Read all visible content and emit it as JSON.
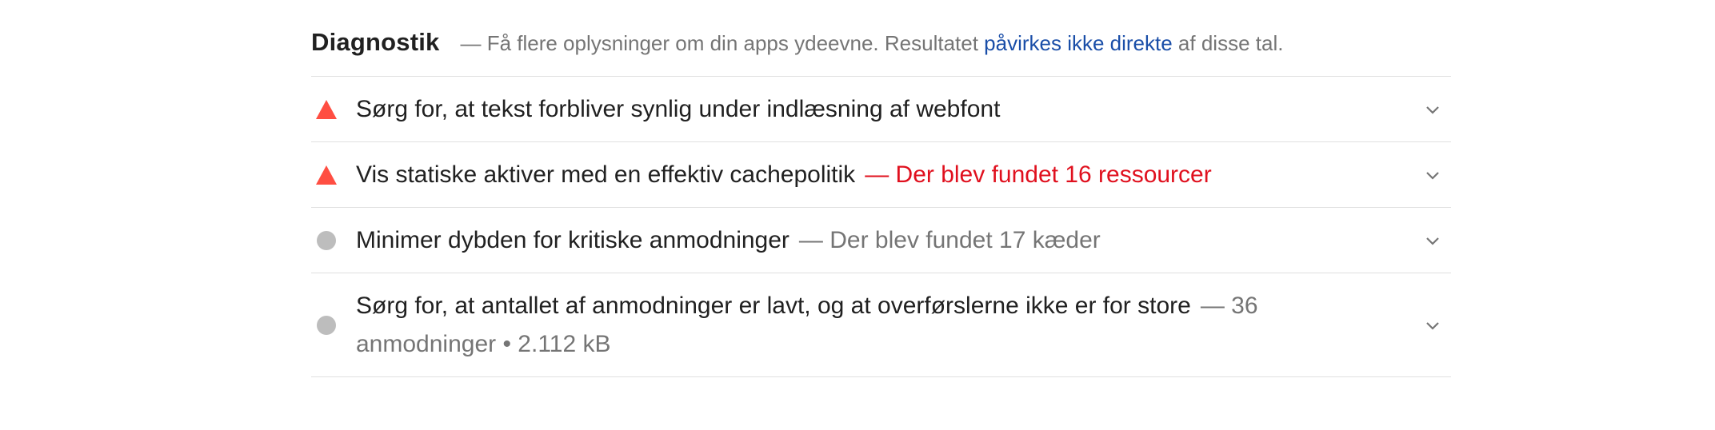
{
  "section": {
    "title": "Diagnostik",
    "desc_prefix": "— Få flere oplysninger om din apps ydeevne. Resultatet ",
    "desc_link": "påvirkes ikke direkte",
    "desc_suffix": " af disse tal."
  },
  "audits": [
    {
      "icon": "warning-triangle-icon",
      "status": "fail",
      "title": "Sørg for, at tekst forbliver synlig under indlæsning af webfont",
      "display_value": ""
    },
    {
      "icon": "warning-triangle-icon",
      "status": "fail",
      "title": "Vis statiske aktiver med en effektiv cachepolitik",
      "display_value": "— Der blev fundet 16 ressourcer"
    },
    {
      "icon": "neutral-circle-icon",
      "status": "informative",
      "title": "Minimer dybden for kritiske anmodninger",
      "display_value": "— Der blev fundet 17 kæder"
    },
    {
      "icon": "neutral-circle-icon",
      "status": "informative",
      "title": "Sørg for, at antallet af anmodninger er lavt, og at overførslerne ikke er for store",
      "display_value": "— 36 anmodninger • 2.112 kB"
    }
  ],
  "colors": {
    "fail": "#ff4e42",
    "fail_text": "#e0101e",
    "neutral": "#bdbdbd",
    "link": "#1a4ea8"
  },
  "chevron_icon": "chevron-down-icon"
}
